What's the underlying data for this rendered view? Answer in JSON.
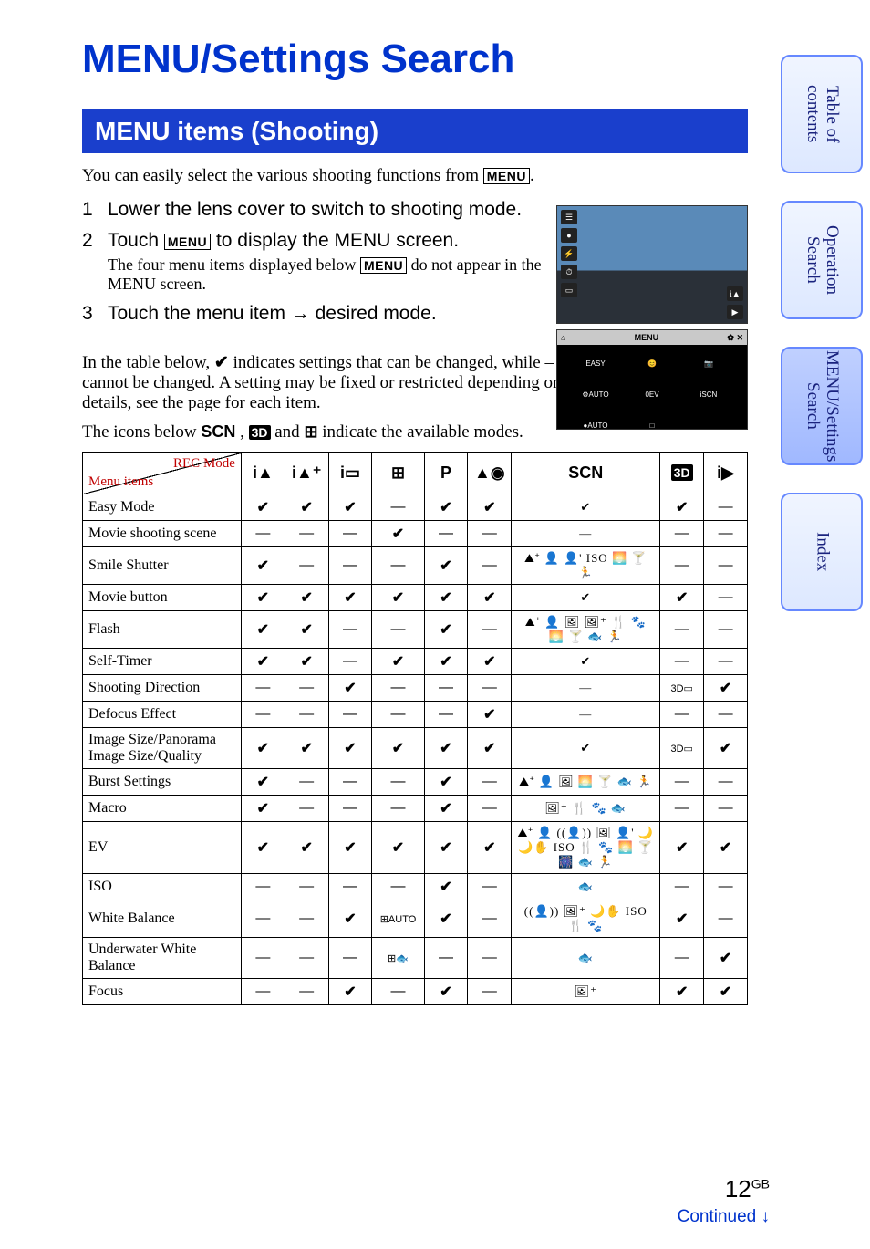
{
  "title": "MENU/Settings Search",
  "section_heading": "MENU items (Shooting)",
  "intro_before": "You can easily select the various shooting functions from ",
  "intro_after": "",
  "intro_period": ".",
  "menu_label": "MENU",
  "steps": [
    {
      "text": "Lower the lens cover to switch to shooting mode.",
      "sub": ""
    },
    {
      "text_before": "Touch ",
      "text_after": " to display the MENU screen.",
      "sub_before": "The four menu items displayed below ",
      "sub_after": " do not appear in the MENU screen."
    },
    {
      "text": "Touch the menu item → desired mode.",
      "sub": ""
    }
  ],
  "illus_menu_title": "MENU",
  "illus_items": [
    "EASY",
    "😊",
    "📷",
    "⚙AUTO",
    "0EV",
    "iSCN",
    "●AUTO",
    "□"
  ],
  "table_intro_1_before": "In the table below, ",
  "check_glyph": "✔",
  "table_intro_1_after": " indicates settings that can be changed, while – indicates settings that cannot be changed. A setting may be fixed or restricted depending on the shooting mode. For details, see the page for each item.",
  "table_intro_2_before": "The icons below ",
  "table_intro_2_mid1": ", ",
  "table_intro_2_mid2": " and ",
  "table_intro_2_after": " indicate the available modes.",
  "scn_label": "SCN",
  "threeD_label": "3D",
  "panorama_glyph": "⊞",
  "header_corner": {
    "top": "REC Mode",
    "bottom": "Menu items"
  },
  "columns": [
    {
      "key": "iA",
      "label": "i▲"
    },
    {
      "key": "iAplus",
      "label": "i▲⁺"
    },
    {
      "key": "iSweep",
      "label": "i▭"
    },
    {
      "key": "movie",
      "label": "⊞"
    },
    {
      "key": "P",
      "label": "P"
    },
    {
      "key": "defocus",
      "label": "▲◉"
    },
    {
      "key": "SCN",
      "label": "SCN"
    },
    {
      "key": "3D",
      "label": "3D"
    },
    {
      "key": "iMovie",
      "label": "i▶"
    }
  ],
  "rows": [
    {
      "name": "Easy Mode",
      "cells": [
        "✔",
        "✔",
        "✔",
        "—",
        "✔",
        "✔",
        "✔",
        "✔",
        "—"
      ],
      "scn": "✔"
    },
    {
      "name": "Movie shooting scene",
      "cells": [
        "—",
        "—",
        "—",
        "✔",
        "—",
        "—",
        "—",
        "—",
        "—"
      ],
      "scn": "—"
    },
    {
      "name": "Smile Shutter",
      "cells": [
        "✔",
        "—",
        "—",
        "—",
        "✔",
        "—",
        "icons",
        "—",
        "—"
      ],
      "scn": "⛰⁺ 👤 👤' ISO 🌅 🍸 🏃"
    },
    {
      "name": "Movie button",
      "cells": [
        "✔",
        "✔",
        "✔",
        "✔",
        "✔",
        "✔",
        "✔",
        "✔",
        "—"
      ],
      "scn": "✔"
    },
    {
      "name": "Flash",
      "cells": [
        "✔",
        "✔",
        "—",
        "—",
        "✔",
        "—",
        "icons",
        "—",
        "—"
      ],
      "scn": "⛰⁺ 👤 🖼 🖼⁺ 🍴 🐾 🌅 🍸 🐟 🏃"
    },
    {
      "name": "Self-Timer",
      "cells": [
        "✔",
        "✔",
        "—",
        "✔",
        "✔",
        "✔",
        "✔",
        "—",
        "—"
      ],
      "scn": "✔"
    },
    {
      "name": "Shooting Direction",
      "cells": [
        "—",
        "—",
        "✔",
        "—",
        "—",
        "—",
        "—",
        "3D▭",
        "✔"
      ],
      "scn": "—"
    },
    {
      "name": "Defocus Effect",
      "cells": [
        "—",
        "—",
        "—",
        "—",
        "—",
        "✔",
        "—",
        "—",
        "—"
      ],
      "scn": "—"
    },
    {
      "name": "Image Size/Panorama Image Size/Quality",
      "cells": [
        "✔",
        "✔",
        "✔",
        "✔",
        "✔",
        "✔",
        "✔",
        "3D▭",
        "✔"
      ],
      "scn": "✔"
    },
    {
      "name": "Burst Settings",
      "cells": [
        "✔",
        "—",
        "—",
        "—",
        "✔",
        "—",
        "icons",
        "—",
        "—"
      ],
      "scn": "⛰⁺ 👤 🖼 🌅 🍸 🐟 🏃"
    },
    {
      "name": "Macro",
      "cells": [
        "✔",
        "—",
        "—",
        "—",
        "✔",
        "—",
        "icons",
        "—",
        "—"
      ],
      "scn": "🖼⁺ 🍴 🐾 🐟"
    },
    {
      "name": "EV",
      "cells": [
        "✔",
        "✔",
        "✔",
        "✔",
        "✔",
        "✔",
        "icons",
        "✔",
        "✔"
      ],
      "scn": "⛰⁺ 👤 ((👤)) 🖼 👤' 🌙 🌙✋ ISO 🍴 🐾 🌅 🍸 🎆 🐟 🏃"
    },
    {
      "name": "ISO",
      "cells": [
        "—",
        "—",
        "—",
        "—",
        "✔",
        "—",
        "icons",
        "—",
        "—"
      ],
      "scn": "🐟"
    },
    {
      "name": "White Balance",
      "cells": [
        "—",
        "—",
        "✔",
        "⊞AUTO",
        "✔",
        "—",
        "icons",
        "✔",
        "—"
      ],
      "scn": "((👤)) 🖼⁺ 🌙✋ ISO 🍴 🐾"
    },
    {
      "name": "Underwater White Balance",
      "cells": [
        "—",
        "—",
        "—",
        "⊞🐟",
        "—",
        "—",
        "icons",
        "—",
        "✔"
      ],
      "scn": "🐟"
    },
    {
      "name": "Focus",
      "cells": [
        "—",
        "—",
        "✔",
        "—",
        "✔",
        "—",
        "icons",
        "✔",
        "✔"
      ],
      "scn": "🖼⁺"
    }
  ],
  "side_tabs": [
    {
      "key": "toc",
      "label": "Table of\ncontents",
      "active": false
    },
    {
      "key": "op",
      "label": "Operation\nSearch",
      "active": false
    },
    {
      "key": "menu",
      "label": "MENU/Settings\nSearch",
      "active": true
    },
    {
      "key": "index",
      "label": "Index",
      "active": false
    }
  ],
  "page_number": "12",
  "page_lang": "GB",
  "continued": "Continued ↓"
}
